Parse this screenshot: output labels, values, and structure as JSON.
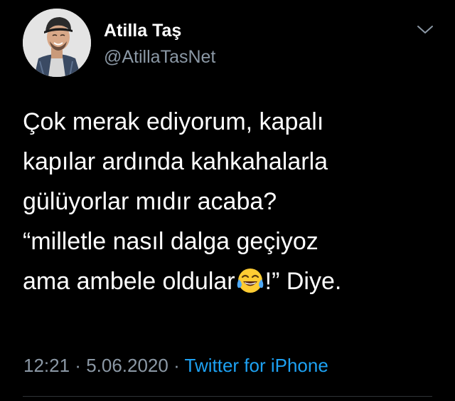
{
  "user": {
    "display_name": "Atilla Taş",
    "handle": "@AtillaTasNet",
    "avatar_icon": "profile-photo"
  },
  "menu": {
    "icon": "chevron-down-icon"
  },
  "tweet": {
    "line1": "Çok merak ediyorum, kapalı",
    "line2": "kapılar ardında kahkahalarla",
    "line3": "gülüyorlar mıdır acaba?",
    "line4": "“milletle nasıl dalga geçiyoz",
    "line5_before": "ama ambele oldular",
    "emoji": "face-with-tears-of-joy",
    "line5_after": "!” Diye."
  },
  "meta": {
    "time": "12:21",
    "sep1": " · ",
    "date": "5.06.2020",
    "sep2": " · ",
    "source": "Twitter for iPhone"
  },
  "colors": {
    "background": "#000000",
    "text": "#ffffff",
    "secondary": "#8b98a5",
    "link": "#1da1f2"
  }
}
